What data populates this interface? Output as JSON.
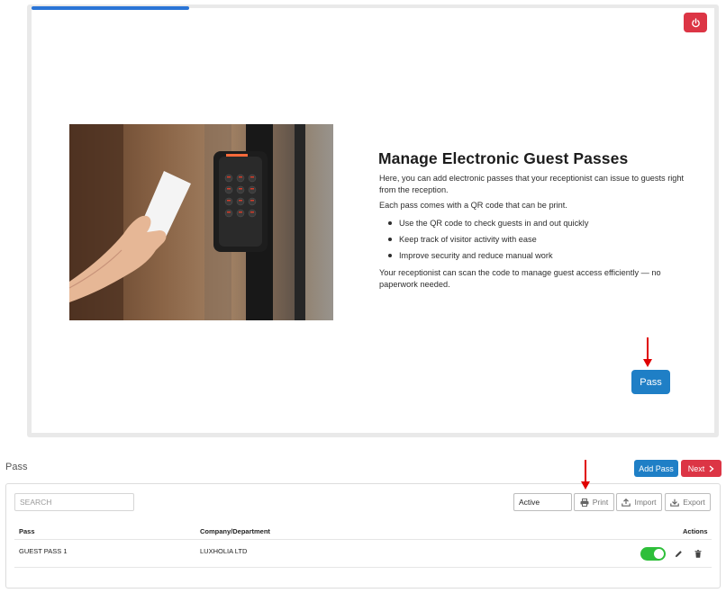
{
  "onboarding": {
    "title": "Manage Electronic Guest Passes",
    "paragraph1": "Here, you can add electronic passes that your receptionist can issue to guests right from the reception.",
    "paragraph2": "Each pass comes with a QR code that can be print.",
    "bullets": [
      "Use the QR code to check guests in and out quickly",
      "Keep track of visitor activity with ease",
      "Improve security and reduce manual work"
    ],
    "paragraph3": "Your receptionist can scan the code to manage guest access efficiently — no paperwork needed.",
    "pass_button": "Pass",
    "progress_fraction": 0.23
  },
  "page": {
    "title": "Pass",
    "add_button": "Add Pass",
    "next_button": "Next"
  },
  "toolbar": {
    "search_placeholder": "SEARCH",
    "status_value": "Active",
    "print_label": "Print",
    "import_label": "Import",
    "export_label": "Export"
  },
  "table": {
    "columns": [
      "Pass",
      "Company/Department",
      "Actions"
    ],
    "rows": [
      {
        "pass": "GUEST PASS 1",
        "company": "LUXHOLIA LTD",
        "active": true
      }
    ]
  },
  "colors": {
    "primary": "#1f7fc6",
    "danger": "#dc3545",
    "toggle_on": "#2ebf3a",
    "arrow": "#e00000"
  },
  "icons": [
    "power-icon",
    "chevron-right-icon",
    "printer-icon",
    "upload-icon",
    "download-icon",
    "pencil-icon",
    "trash-icon",
    "arrow-down-icon"
  ]
}
